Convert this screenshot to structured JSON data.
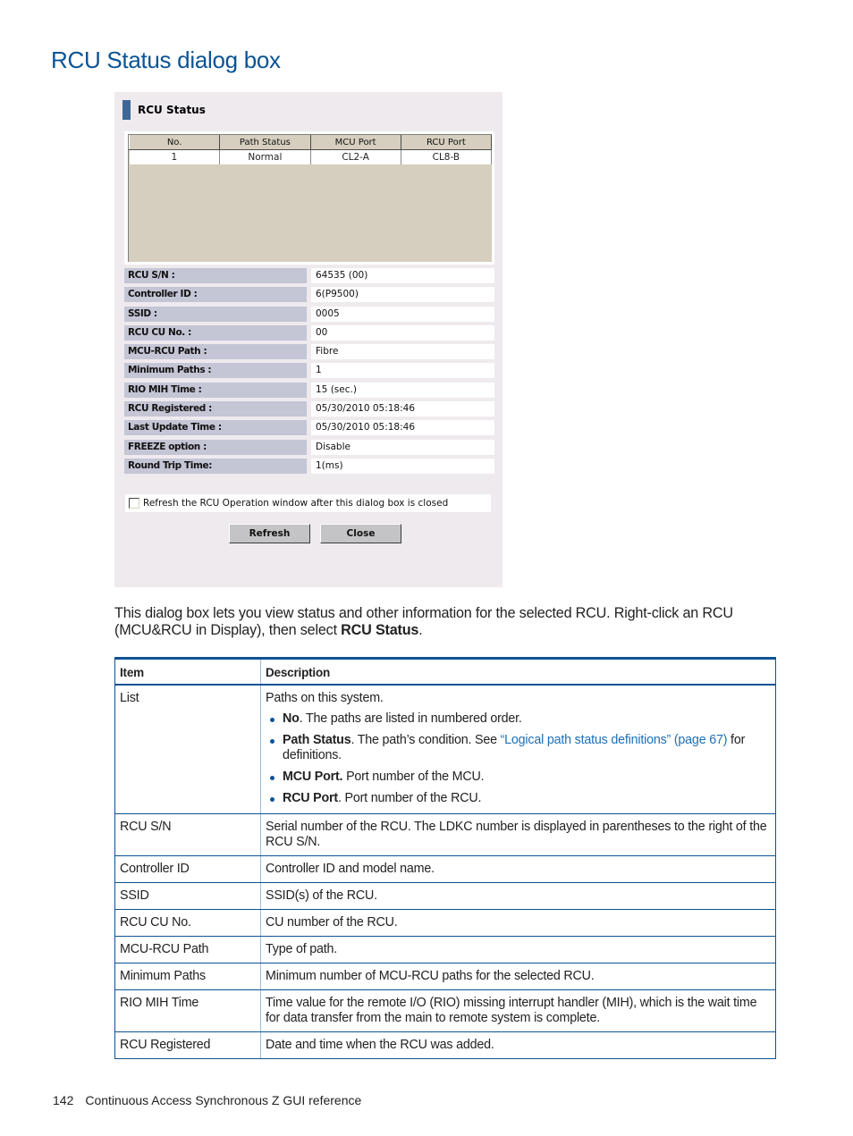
{
  "page": {
    "title": "RCU Status dialog box",
    "intro_text": "This dialog box lets you view status and other information for the selected RCU. Right-click an RCU (MCU&RCU in Display), then select ",
    "intro_bold": "RCU Status",
    "intro_end": ".",
    "footer_page": "142",
    "footer_text": "Continuous Access Synchronous Z GUI reference"
  },
  "dialog": {
    "title": "RCU Status",
    "header_color": "#3f6795",
    "paths_table": {
      "columns": [
        "No.",
        "Path Status",
        "MCU Port",
        "RCU Port"
      ],
      "rows": [
        [
          "1",
          "Normal",
          "CL2-A",
          "CL8-B"
        ]
      ]
    },
    "properties": [
      {
        "label": "RCU S/N :",
        "value": "64535 (00)"
      },
      {
        "label": "Controller ID :",
        "value": "6(P9500)"
      },
      {
        "label": "SSID :",
        "value": "0005"
      },
      {
        "label": "RCU CU No. :",
        "value": "00"
      },
      {
        "label": "MCU-RCU Path :",
        "value": "Fibre"
      },
      {
        "label": "Minimum Paths :",
        "value": "1"
      },
      {
        "label": "RIO MIH Time :",
        "value": "15 (sec.)"
      },
      {
        "label": "RCU Registered :",
        "value": "05/30/2010 05:18:46"
      },
      {
        "label": "Last Update Time :",
        "value": "05/30/2010 05:18:46"
      },
      {
        "label": "FREEZE option :",
        "value": "Disable"
      },
      {
        "label": "Round Trip Time:",
        "value": "1(ms)"
      }
    ],
    "refresh_checkbox": {
      "label": "Refresh the RCU Operation window after this dialog box is closed",
      "checked": false
    },
    "buttons": {
      "refresh": "Refresh",
      "close": "Close"
    }
  },
  "desc_table": {
    "headers": {
      "item": "Item",
      "description": "Description"
    },
    "list_row": {
      "item": "List",
      "intro": "Paths on this system.",
      "bullets": [
        {
          "term": "No",
          "text": ". The paths are listed in numbered order."
        },
        {
          "term": "Path Status",
          "text": ". The path’s condition. See ",
          "link": "“Logical path status definitions” (page 67)",
          "after": " for definitions."
        },
        {
          "term": "MCU Port.",
          "text": " Port number of the MCU."
        },
        {
          "term": "RCU Port",
          "text": ". Port number of the RCU."
        }
      ]
    },
    "rows": [
      {
        "item": "RCU S/N",
        "description": "Serial number of the RCU. The LDKC number is displayed in parentheses to the right of the RCU S/N."
      },
      {
        "item": "Controller ID",
        "description": "Controller ID and model name."
      },
      {
        "item": "SSID",
        "description": "SSID(s) of the RCU."
      },
      {
        "item": "RCU CU No.",
        "description": "CU number of the RCU."
      },
      {
        "item": "MCU-RCU Path",
        "description": "Type of path."
      },
      {
        "item": "Minimum Paths",
        "description": "Minimum number of MCU-RCU paths for the selected RCU."
      },
      {
        "item": "RIO MIH Time",
        "description": "Time value for the remote I/O (RIO) missing interrupt handler (MIH), which is the wait time for data transfer from the main to remote system is complete."
      },
      {
        "item": "RCU Registered",
        "description": "Date and time when the RCU was added."
      }
    ]
  }
}
